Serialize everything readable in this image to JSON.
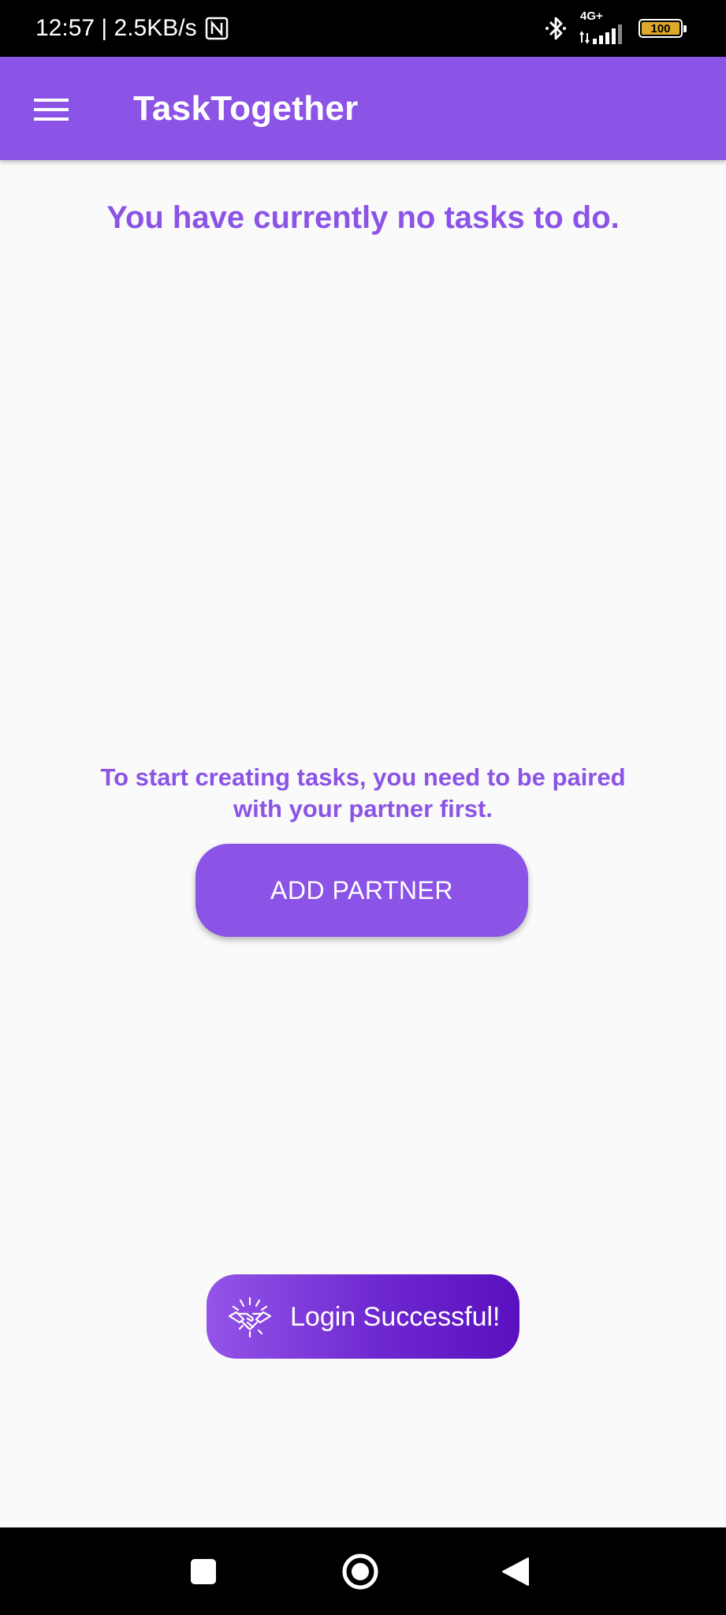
{
  "status_bar": {
    "time_speed": "12:57 | 2.5KB/s",
    "network_type": "4G+",
    "battery_level": "100",
    "icons": [
      "nfc-icon",
      "bluetooth-icon",
      "signal-icon",
      "battery-icon"
    ]
  },
  "app_bar": {
    "title": "TaskTogether",
    "menu_icon": "menu-icon"
  },
  "content": {
    "empty_message": "You have currently no tasks to do.",
    "pairing_hint": "To start creating tasks, you need to be paired with your partner first.",
    "add_partner_label": "ADD PARTNER"
  },
  "toast": {
    "icon": "handshake-icon",
    "message": "Login Successful!"
  },
  "nav_bar": {
    "buttons": [
      "recents-icon",
      "home-icon",
      "back-icon"
    ]
  },
  "colors": {
    "primary": "#8b53e6",
    "toast_gradient_start": "#9454e8",
    "toast_gradient_end": "#5a10bf",
    "background": "#fafafa",
    "battery_fill": "#e0a82a"
  }
}
